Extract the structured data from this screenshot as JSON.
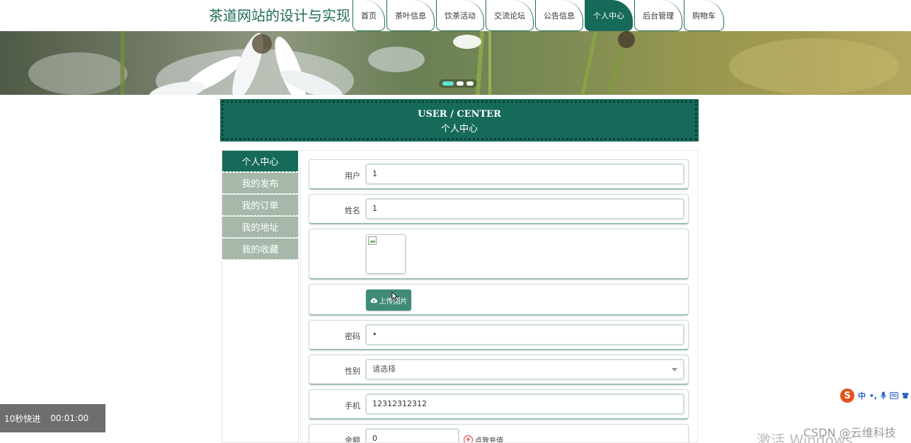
{
  "site": {
    "title": "茶道网站的设计与实现"
  },
  "nav": {
    "tabs": [
      {
        "label": "首页"
      },
      {
        "label": "茶叶信息"
      },
      {
        "label": "饮茶活动"
      },
      {
        "label": "交流论坛"
      },
      {
        "label": "公告信息"
      },
      {
        "label": "个人中心"
      },
      {
        "label": "后台管理"
      },
      {
        "label": "购物车"
      }
    ],
    "active_index": 5
  },
  "banner": {
    "slide_count": 3,
    "active_slide": 0
  },
  "section": {
    "title_en": "USER / CENTER",
    "title_cn": "个人中心"
  },
  "sidebar": {
    "items": [
      {
        "label": "个人中心"
      },
      {
        "label": "我的发布"
      },
      {
        "label": "我的订单"
      },
      {
        "label": "我的地址"
      },
      {
        "label": "我的收藏"
      }
    ],
    "active_index": 0
  },
  "form": {
    "user_label": "用户",
    "user_value": "1",
    "name_label": "姓名",
    "name_value": "1",
    "upload_label": "上传图片",
    "password_label": "密码",
    "password_value": "•",
    "gender_label": "性别",
    "gender_value": "请选择",
    "phone_label": "手机",
    "phone_value": "12312312312",
    "balance_label": "余额",
    "balance_value": "0",
    "recharge_label": "点我充值"
  },
  "video": {
    "skip_label": "10秒快进",
    "time": "00:01:00"
  },
  "ime": {
    "mode": "中",
    "punct": "•,"
  },
  "watermarks": {
    "csdn": "CSDN @云维科技",
    "windows": "激活 Windows"
  },
  "colors": {
    "primary": "#166a5a",
    "sidebar_inactive": "#a5b8aa",
    "upload_button": "#3f8b77"
  }
}
